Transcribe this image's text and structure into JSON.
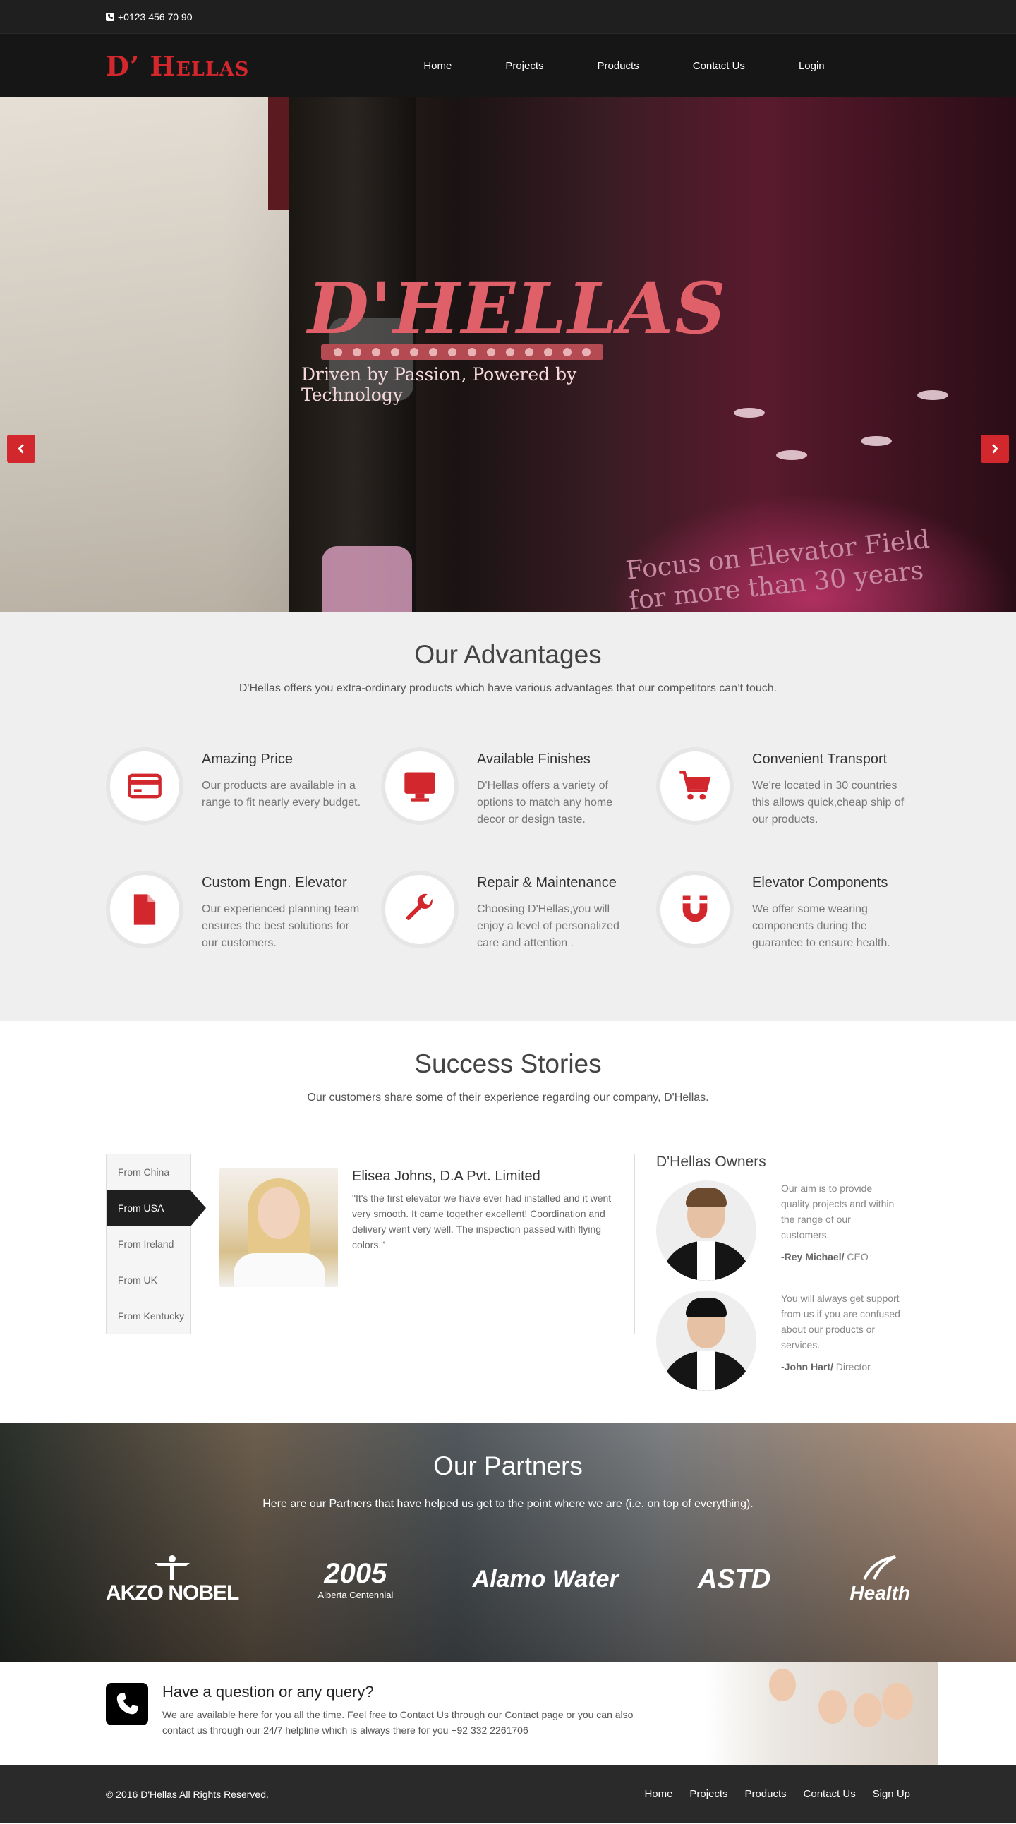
{
  "topbar": {
    "phone": "+0123 456 70 90"
  },
  "nav": {
    "logo": {
      "first": "D’ H",
      "rest": "ELLAS"
    },
    "menu": [
      "Home",
      "Projects",
      "Products",
      "Contact Us",
      "Login"
    ]
  },
  "hero": {
    "brand": "D'HELLAS",
    "tagline": "Driven by Passion, Powered by Technology",
    "slogan": "Focus on Elevator Field for more than 30 years",
    "slides": 3,
    "active_slide": 1
  },
  "advantages": {
    "title": "Our Advantages",
    "subtitle": "D'Hellas offers you extra-ordinary products which have various advantages that our competitors can’t touch.",
    "items": [
      {
        "icon": "credit-card-icon",
        "title": "Amazing Price",
        "text": "Our products are available in a range to fit nearly every budget."
      },
      {
        "icon": "monitor-icon",
        "title": "Available Finishes",
        "text": "D'Hellas offers a variety of options to match any home decor or design taste."
      },
      {
        "icon": "cart-icon",
        "title": "Convenient Transport",
        "text": "We're located in 30 countries this allows quick,cheap ship of our products."
      },
      {
        "icon": "document-icon",
        "title": "Custom Engn. Elevator",
        "text": "Our experienced planning team ensures the best solutions for our customers."
      },
      {
        "icon": "wrench-icon",
        "title": "Repair & Maintenance",
        "text": "Choosing D'Hellas,you will enjoy a level of personalized care and attention ."
      },
      {
        "icon": "magnet-icon",
        "title": "Elevator Components",
        "text": "We offer some wearing components during the guarantee to ensure health."
      }
    ]
  },
  "success": {
    "title": "Success Stories",
    "subtitle": "Our customers share some of their experience regarding our company, D'Hellas.",
    "tabs": [
      "From China",
      "From USA",
      "From Ireland",
      "From UK",
      "From Kentucky"
    ],
    "active_tab": 1,
    "testimonial": {
      "name": "Elisea Johns, D.A Pvt. Limited",
      "text": "\"It's the first elevator we have ever had installed and it went very smooth. It came together excellent! Coordination and delivery went very well. The inspection passed with flying colors.\""
    },
    "owners": {
      "title": "D'Hellas Owners",
      "list": [
        {
          "quote": "Our aim is to provide quality projects and within the range of our customers.",
          "name": "-Rey Michael/",
          "role": " CEO"
        },
        {
          "quote": "You will always get support from us if you are confused about our products or services.",
          "name": "-John Hart/",
          "role": " Director"
        }
      ]
    }
  },
  "partners": {
    "title": "Our Partners",
    "subtitle": "Here are our Partners that have helped us get to the point where we are (i.e. on top of everything).",
    "logos": [
      {
        "name": "AKZO NOBEL"
      },
      {
        "name": "2005",
        "caption": "Alberta Centennial"
      },
      {
        "name": "Alamo Water"
      },
      {
        "name": "ASTD"
      },
      {
        "name": "Health"
      }
    ]
  },
  "query": {
    "title": "Have a question or any query?",
    "text": "We are available here for you all the time. Feel free to Contact Us through our Contact page or you can also contact us through our 24/7 helpline which is always there for you +92 332 2261706"
  },
  "footer": {
    "copyright": "© 2016 D'Hellas All Rights Reserved.",
    "links": [
      "Home",
      "Projects",
      "Products",
      "Contact Us",
      "Sign Up"
    ]
  },
  "colors": {
    "accent": "#d1272d",
    "dark": "#1f1f1f"
  }
}
